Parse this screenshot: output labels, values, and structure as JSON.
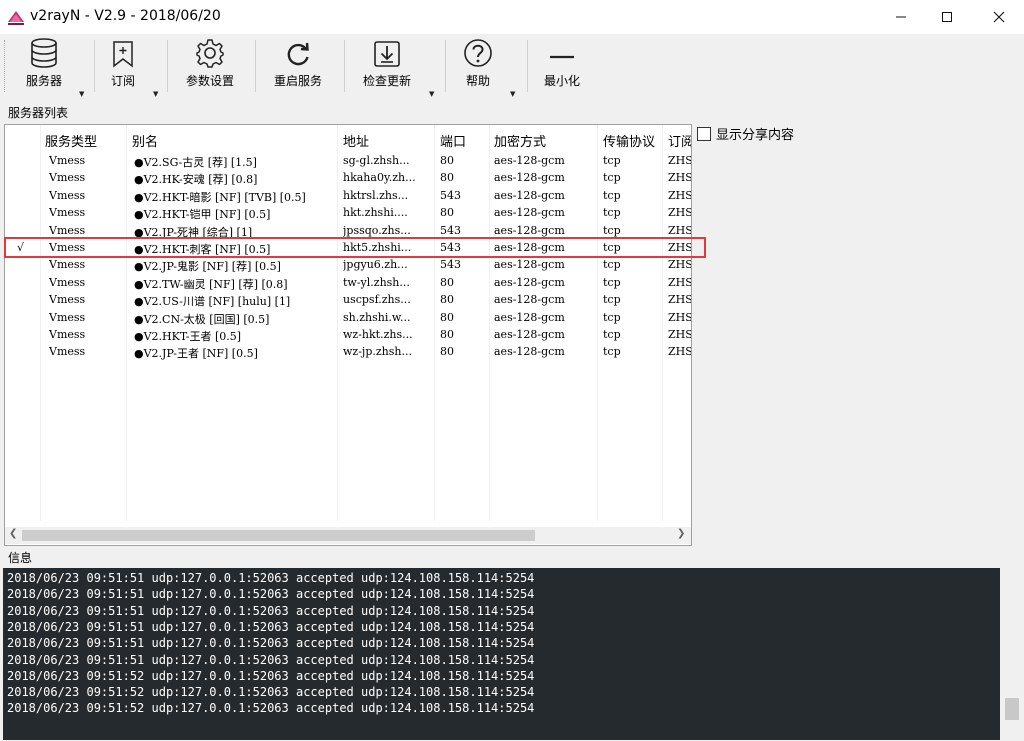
{
  "window": {
    "title": "v2rayN - V2.9 - 2018/06/20",
    "app_icon": "v2rayn-logo",
    "controls": {
      "minimize": "minimize-icon",
      "maximize": "maximize-icon",
      "close": "close-icon"
    }
  },
  "toolbar": {
    "items": [
      {
        "label": "服务器",
        "icon": "database-icon",
        "dropdown": true
      },
      {
        "label": "订阅",
        "icon": "bookmark-add-icon",
        "dropdown": true
      },
      {
        "label": "参数设置",
        "icon": "gear-icon",
        "dropdown": false
      },
      {
        "label": "重启服务",
        "icon": "refresh-icon",
        "dropdown": false
      },
      {
        "label": "检查更新",
        "icon": "download-icon",
        "dropdown": true
      },
      {
        "label": "帮助",
        "icon": "help-icon",
        "dropdown": true
      },
      {
        "label": "最小化",
        "icon": "minus-icon",
        "dropdown": false
      }
    ]
  },
  "server_list": {
    "label": "服务器列表",
    "columns": [
      "",
      "服务类型",
      "别名",
      "地址",
      "端口",
      "加密方式",
      "传输协议",
      "订阅"
    ],
    "rows": [
      {
        "active": "",
        "type": "Vmess",
        "alias": "●V2.SG-古灵 [荐] [1.5]",
        "address": "sg-gl.zhsh...",
        "port": "80",
        "security": "aes-128-gcm",
        "network": "tcp",
        "sub": "ZHS"
      },
      {
        "active": "",
        "type": "Vmess",
        "alias": "●V2.HK-安魂 [荐] [0.8]",
        "address": "hkaha0y.zh...",
        "port": "80",
        "security": "aes-128-gcm",
        "network": "tcp",
        "sub": "ZHS"
      },
      {
        "active": "",
        "type": "Vmess",
        "alias": "●V2.HKT-暗影 [NF] [TVB] [0.5]",
        "address": "hktrsl.zhs...",
        "port": "543",
        "security": "aes-128-gcm",
        "network": "tcp",
        "sub": "ZHS"
      },
      {
        "active": "",
        "type": "Vmess",
        "alias": "●V2.HKT-铠甲 [NF] [0.5]",
        "address": "hkt.zhshi....",
        "port": "80",
        "security": "aes-128-gcm",
        "network": "tcp",
        "sub": "ZHS"
      },
      {
        "active": "",
        "type": "Vmess",
        "alias": "●V2.JP-死神 [综合] [1]",
        "address": "jpssqo.zhs...",
        "port": "543",
        "security": "aes-128-gcm",
        "network": "tcp",
        "sub": "ZHS"
      },
      {
        "active": "√",
        "type": "Vmess",
        "alias": "●V2.HKT-刺客 [NF] [0.5]",
        "address": "hkt5.zhshi...",
        "port": "543",
        "security": "aes-128-gcm",
        "network": "tcp",
        "sub": "ZHS"
      },
      {
        "active": "",
        "type": "Vmess",
        "alias": "●V2.JP-鬼影 [NF] [荐] [0.5]",
        "address": " jpgyu6.zh...",
        "port": "543",
        "security": "aes-128-gcm",
        "network": "tcp",
        "sub": "ZHS"
      },
      {
        "active": "",
        "type": "Vmess",
        "alias": "●V2.TW-幽灵 [NF] [荐] [0.8]",
        "address": "tw-yl.zhsh...",
        "port": "80",
        "security": "aes-128-gcm",
        "network": "tcp",
        "sub": "ZHS"
      },
      {
        "active": "",
        "type": "Vmess",
        "alias": "●V2.US-川谱 [NF] [hulu] [1]",
        "address": "uscpsf.zhs...",
        "port": "80",
        "security": "aes-128-gcm",
        "network": "tcp",
        "sub": "ZHS"
      },
      {
        "active": "",
        "type": "Vmess",
        "alias": "●V2.CN-太极 [回国] [0.5]",
        "address": "sh.zhshi.w...",
        "port": "80",
        "security": "aes-128-gcm",
        "network": "tcp",
        "sub": "ZHS"
      },
      {
        "active": "",
        "type": "Vmess",
        "alias": "●V2.HKT-王者 [0.5]",
        "address": "wz-hkt.zhs...",
        "port": "80",
        "security": "aes-128-gcm",
        "network": "tcp",
        "sub": "ZHS"
      },
      {
        "active": "",
        "type": "Vmess",
        "alias": "●V2.JP-王者 [NF] [0.5]",
        "address": "wz-jp.zhsh...",
        "port": "80",
        "security": "aes-128-gcm",
        "network": "tcp",
        "sub": "ZHS"
      }
    ]
  },
  "share_option": {
    "label": "显示分享内容",
    "checked": false
  },
  "log": {
    "label": "信息",
    "lines": [
      "2018/06/23 09:51:51 udp:127.0.0.1:52063 accepted udp:124.108.158.114:5254",
      "2018/06/23 09:51:51 udp:127.0.0.1:52063 accepted udp:124.108.158.114:5254",
      "2018/06/23 09:51:51 udp:127.0.0.1:52063 accepted udp:124.108.158.114:5254",
      "2018/06/23 09:51:51 udp:127.0.0.1:52063 accepted udp:124.108.158.114:5254",
      "2018/06/23 09:51:51 udp:127.0.0.1:52063 accepted udp:124.108.158.114:5254",
      "2018/06/23 09:51:51 udp:127.0.0.1:52063 accepted udp:124.108.158.114:5254",
      "2018/06/23 09:51:52 udp:127.0.0.1:52063 accepted udp:124.108.158.114:5254",
      "2018/06/23 09:51:52 udp:127.0.0.1:52063 accepted udp:124.108.158.114:5254",
      "2018/06/23 09:51:52 udp:127.0.0.1:52063 accepted udp:124.108.158.114:5254"
    ]
  },
  "colors": {
    "log_bg": "#252a2e",
    "highlight": "#e23a3a"
  }
}
